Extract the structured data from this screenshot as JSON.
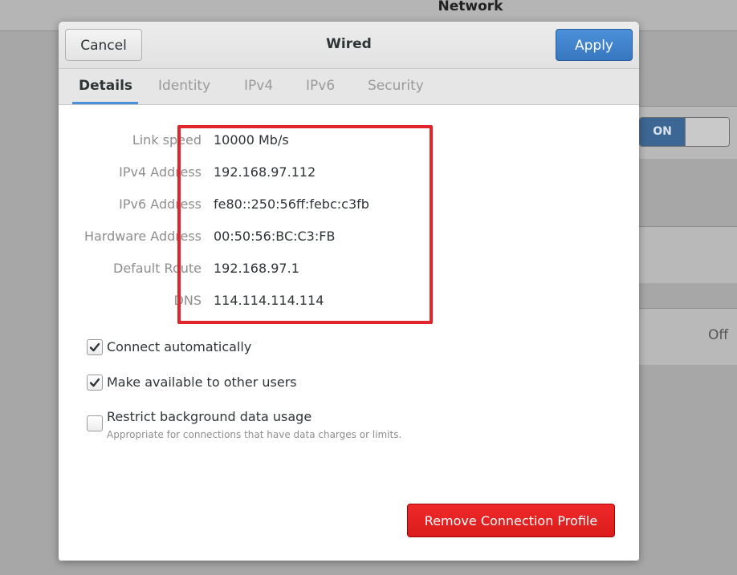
{
  "background": {
    "window_title": "Network",
    "switch_label": "ON",
    "off_label": "Off"
  },
  "dialog": {
    "title": "Wired",
    "cancel_label": "Cancel",
    "apply_label": "Apply",
    "tabs": [
      {
        "label": "Details",
        "active": true
      },
      {
        "label": "Identity",
        "active": false
      },
      {
        "label": "IPv4",
        "active": false
      },
      {
        "label": "IPv6",
        "active": false
      },
      {
        "label": "Security",
        "active": false
      }
    ],
    "details": [
      {
        "label": "Link speed",
        "value": "10000 Mb/s"
      },
      {
        "label": "IPv4 Address",
        "value": "192.168.97.112"
      },
      {
        "label": "IPv6 Address",
        "value": "fe80::250:56ff:febc:c3fb"
      },
      {
        "label": "Hardware Address",
        "value": "00:50:56:BC:C3:FB"
      },
      {
        "label": "Default Route",
        "value": "192.168.97.1"
      },
      {
        "label": "DNS",
        "value": "114.114.114.114"
      }
    ],
    "options": {
      "connect_automatically": {
        "label": "Connect automatically",
        "checked": true
      },
      "available_to_others": {
        "label": "Make available to other users",
        "checked": true
      },
      "restrict_background": {
        "label": "Restrict background data usage",
        "sublabel": "Appropriate for connections that have data charges or limits.",
        "checked": false
      }
    },
    "remove_label": "Remove Connection Profile"
  },
  "colors": {
    "accent": "#4a90d9",
    "destructive": "#e01b24",
    "highlight_box": "#e0242c"
  }
}
